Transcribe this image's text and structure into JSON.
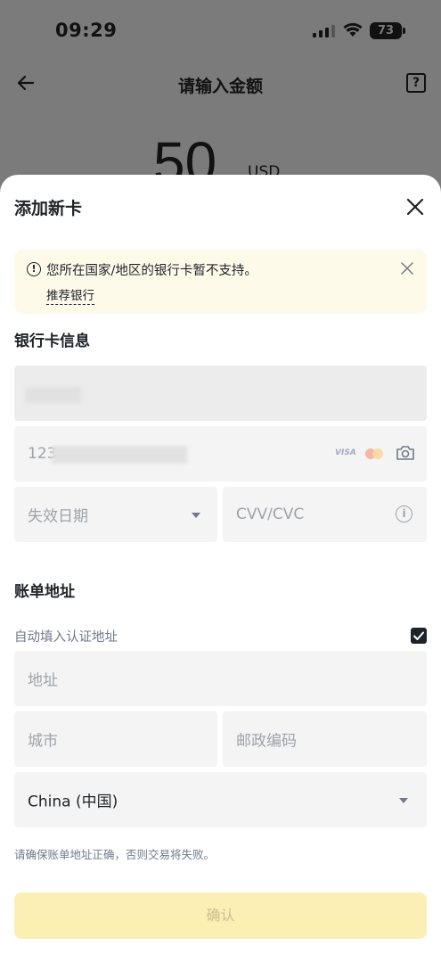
{
  "status_bar": {
    "time": "09:29",
    "battery": "73"
  },
  "background_page": {
    "title": "请输入金额",
    "amount": "50",
    "currency": "USD"
  },
  "sheet": {
    "title": "添加新卡",
    "notice": {
      "text": "您所在国家/地区的银行卡暂不支持。",
      "link": "推荐银行"
    },
    "card_section": {
      "heading": "银行卡信息",
      "card_number_prefix": "123",
      "card_brands": [
        "VISA",
        "Mastercard"
      ],
      "expiry_placeholder": "失效日期",
      "cvv_placeholder": "CVV/CVC"
    },
    "billing_section": {
      "heading": "账单地址",
      "autofill_label": "自动填入认证地址",
      "autofill_checked": true,
      "address_placeholder": "地址",
      "city_placeholder": "城市",
      "postal_placeholder": "邮政编码",
      "country_value": "China (中国)"
    },
    "hint": "请确保账单地址正确，否则交易将失败。",
    "confirm_label": "确认"
  },
  "colors": {
    "accent": "#fcd535",
    "notice_bg": "#fefaea",
    "field_bg": "#f4f4f4"
  }
}
